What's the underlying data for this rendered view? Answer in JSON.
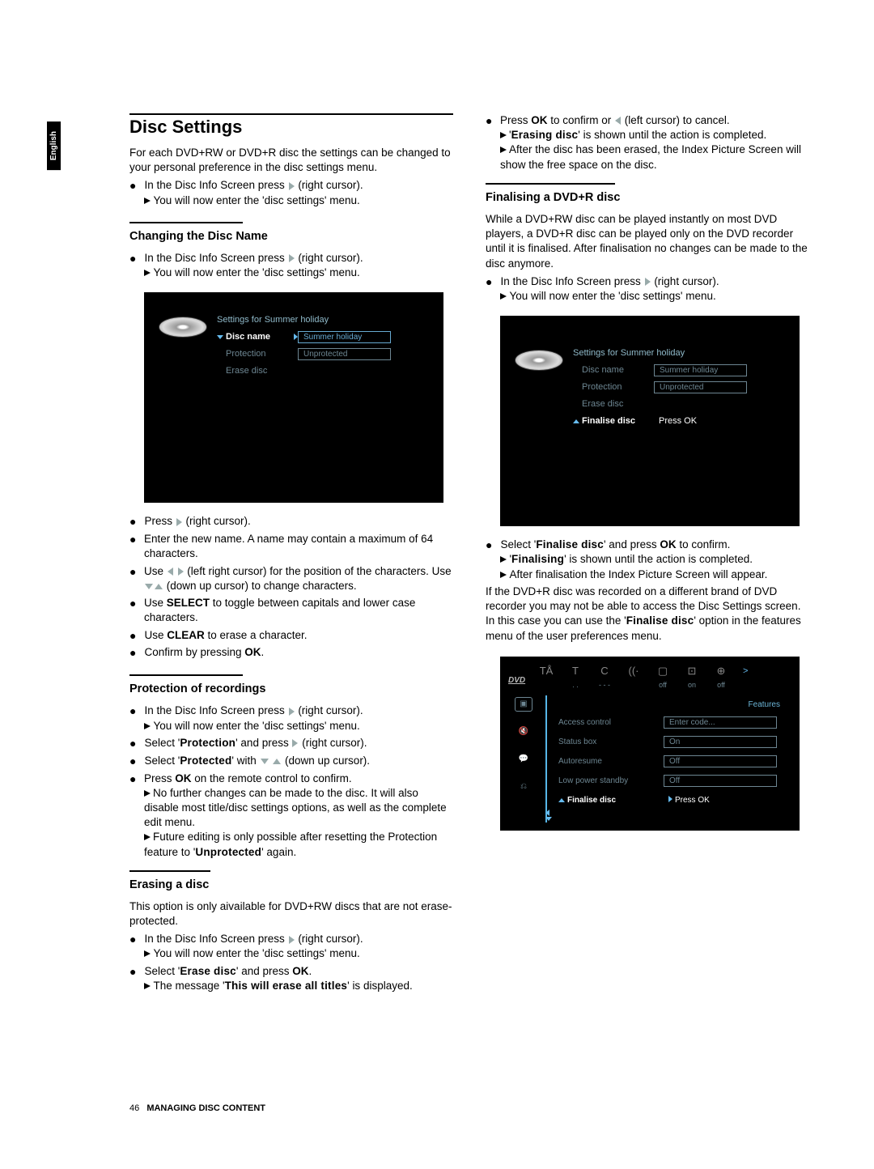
{
  "language_tab": "English",
  "title": "Disc Settings",
  "intro": "For each DVD+RW or DVD+R disc the settings can be changed to your personal preference in the disc settings menu.",
  "common_step": "In the Disc Info Screen press ▷ (right cursor).",
  "common_result": "You will now enter the 'disc settings' menu.",
  "s1": {
    "heading": "Changing the Disc Name",
    "step1": "In the Disc Info Screen press ▷ (right cursor).",
    "result1": "You will now enter the 'disc settings' menu.",
    "shot_title": "Settings for Summer holiday",
    "opt1": "Disc name",
    "opt2": "Protection",
    "opt3": "Erase disc",
    "val1": "Summer holiday",
    "val2": "Unprotected",
    "b2": "Press ▷  (right cursor).",
    "b3": "Enter the new name. A name may contain a maximum of 64 characters.",
    "b4": "Use ◁ ▷ (left right cursor) for the position of the characters. Use ▽△ (down up cursor) to change characters.",
    "b5a": "Use ",
    "b5b": "SELECT",
    "b5c": " to toggle between capitals and lower case characters.",
    "b6a": "Use ",
    "b6b": "CLEAR",
    "b6c": " to erase a character.",
    "b7a": "Confirm by pressing ",
    "b7b": "OK",
    "b7c": "."
  },
  "s2": {
    "heading": "Protection of recordings",
    "b1": "In the Disc Info Screen press ▷ (right cursor).",
    "r1": "You will now enter the 'disc settings' menu.",
    "b2a": "Select '",
    "b2b": "Protection",
    "b2c": "' and press ▷ (right cursor).",
    "b3a": "Select '",
    "b3b": "Protected",
    "b3c": "' with ▽ △ (down up cursor).",
    "b4a": "Press ",
    "b4b": "OK",
    "b4c": " on the remote control to confirm.",
    "r4a": "No further changes can be made to the disc. It will also disable most title/disc settings options, as well as the complete edit menu.",
    "r4b_1": "Future editing is only possible after resetting the Protection feature to '",
    "r4b_2": "Unprotected",
    "r4b_3": "' again."
  },
  "s3": {
    "heading": "Erasing a disc",
    "intro": "This option is only aivailable for DVD+RW discs that are not erase-protected.",
    "b1": "In the Disc Info Screen press ▷ (right cursor).",
    "r1": "You will now enter the 'disc settings' menu.",
    "b2a": "Select '",
    "b2b": "Erase disc",
    "b2c": "' and press ",
    "b2d": "OK",
    "b2e": ".",
    "r2a": "The message '",
    "r2b": "This will erase all titles",
    "r2c": "' is displayed."
  },
  "right": {
    "b1a": "Press ",
    "b1b": "OK",
    "b1c": " to confirm or ◁ (left cursor) to cancel.",
    "r1a": "'",
    "r1b": "Erasing disc",
    "r1c": "' is shown until the action is completed.",
    "r1d": "After the disc has been erased, the Index Picture Screen will show the free space on the disc."
  },
  "s4": {
    "heading": "Finalising a DVD+R disc",
    "intro": "While a DVD+RW disc can be played instantly on most DVD players, a DVD+R disc can be played only on the DVD recorder until it is finalised. After finalisation no changes can be made to the disc anymore.",
    "b1": "In the Disc Info Screen press ▷ (right cursor).",
    "r1": "You will now enter the 'disc settings' menu.",
    "shot_title": "Settings for Summer holiday",
    "opt1": "Disc name",
    "opt2": "Protection",
    "opt3": "Erase disc",
    "opt4": "Finalise disc",
    "val1": "Summer holiday",
    "val2": "Unprotected",
    "val4": "Press OK",
    "b2a": "Select '",
    "b2b": "Finalise disc",
    "b2c": "' and press ",
    "b2d": "OK",
    "b2e": " to confirm.",
    "r2a": "'",
    "r2b": "Finalising",
    "r2c": "' is shown until the action is completed.",
    "r2d": "After finalisation the Index Picture Screen will appear.",
    "p2_1": "If the DVD+R disc was recorded on a different brand of DVD recorder you may not be able to access the Disc Settings screen. In this case you can use the '",
    "p2_2": "Finalise disc",
    "p2_3": "' option in the features menu of the user preferences menu."
  },
  "ss3": {
    "top_icons": [
      "TÅ",
      "T",
      "C",
      "((·",
      "▢",
      "⊡",
      "⊕"
    ],
    "top_vals": [
      "",
      "..",
      "---",
      "",
      "off",
      "on",
      "off"
    ],
    "logo": "DVD",
    "features": "Features",
    "rows": [
      {
        "label": "Access control",
        "value": "Enter code..."
      },
      {
        "label": "Status box",
        "value": "On"
      },
      {
        "label": "Autoresume",
        "value": "Off"
      },
      {
        "label": "Low power standby",
        "value": "Off"
      },
      {
        "label": "Finalise disc",
        "value": "Press OK",
        "active": true
      }
    ]
  },
  "footer": {
    "page": "46",
    "section": "MANAGING DISC CONTENT"
  }
}
